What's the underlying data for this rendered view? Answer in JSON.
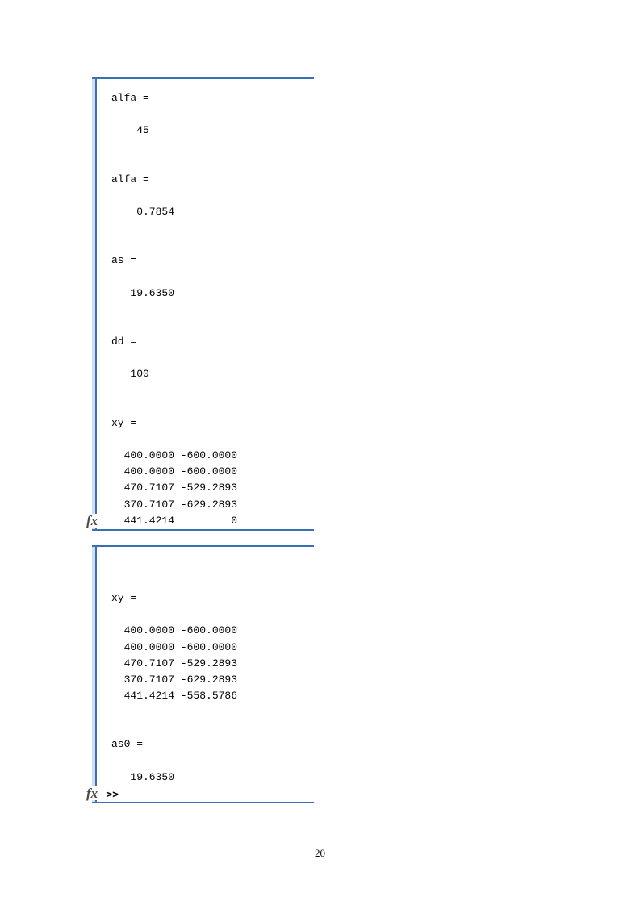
{
  "panel1": {
    "text": "alfa =\n\n    45\n\n\nalfa =\n\n    0.7854\n\n\nas =\n\n   19.6350\n\n\ndd =\n\n   100\n\n\nxy =\n\n  400.0000 -600.0000\n  400.0000 -600.0000\n  470.7107 -529.2893\n  370.7107 -629.2893\n  441.4214         0",
    "fx": "fx"
  },
  "panel2": {
    "text": "\n\nxy =\n\n  400.0000 -600.0000\n  400.0000 -600.0000\n  470.7107 -529.2893\n  370.7107 -629.2893\n  441.4214 -558.5786\n\n\nas0 =\n\n   19.6350\n\n",
    "fx": "fx",
    "prompt": ">>"
  },
  "page_number": "20"
}
